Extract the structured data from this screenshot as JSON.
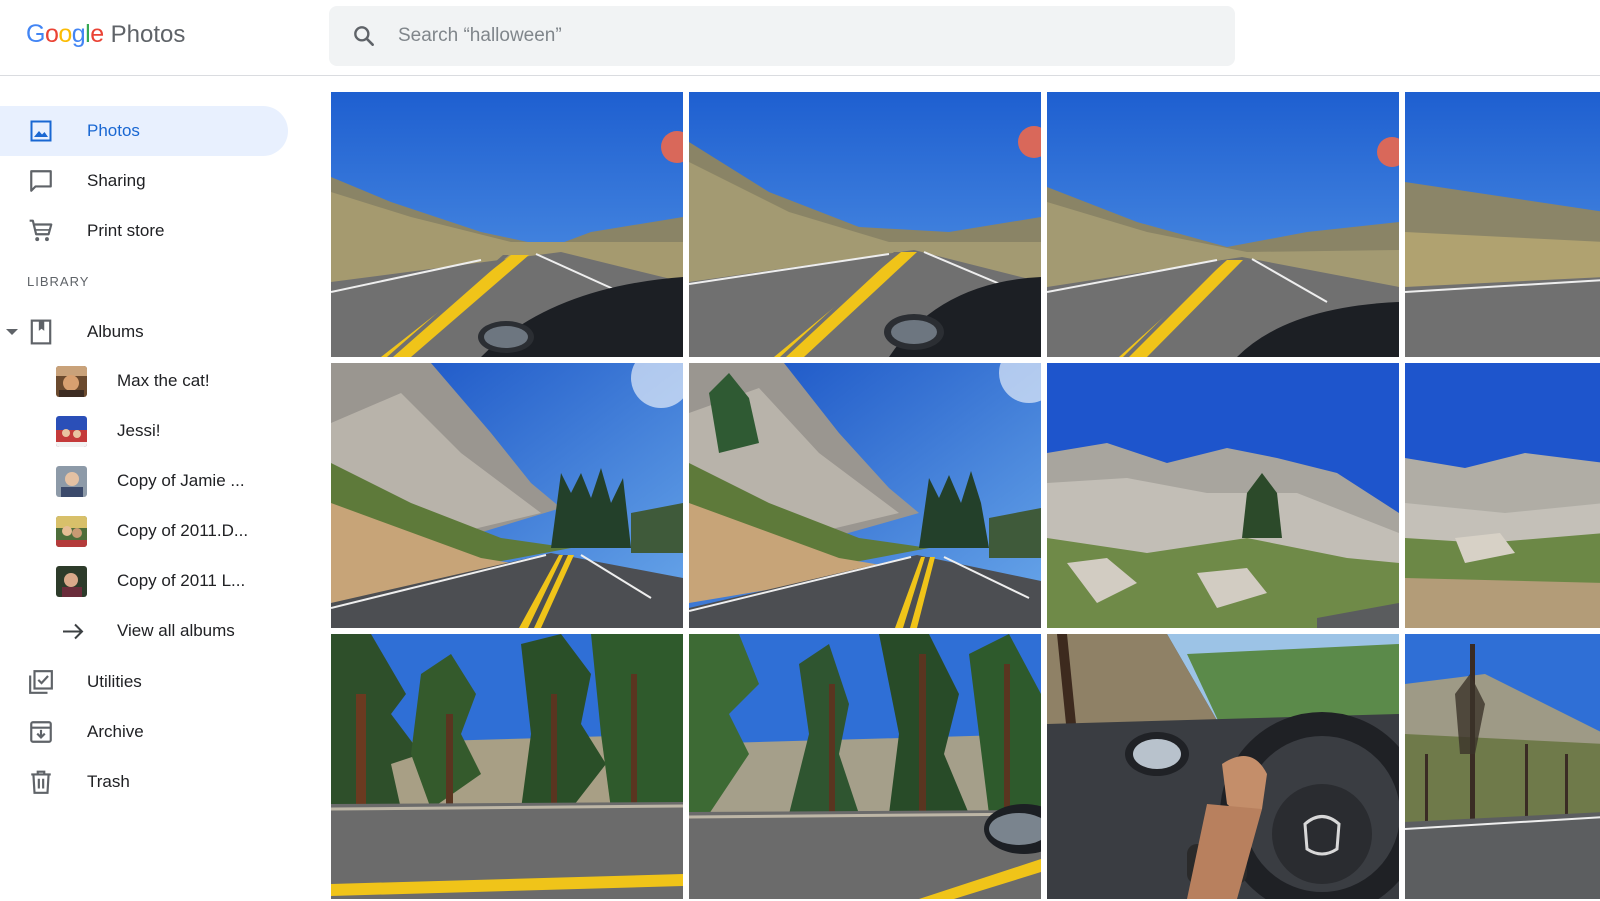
{
  "app": {
    "logo_google": "Google",
    "logo_product": "Photos"
  },
  "search": {
    "placeholder": "Search “halloween”",
    "icon": "search-icon"
  },
  "sidebar": {
    "nav": [
      {
        "label": "Photos",
        "icon": "photo-icon",
        "active": true
      },
      {
        "label": "Sharing",
        "icon": "chat-bubble-icon",
        "active": false
      },
      {
        "label": "Print store",
        "icon": "shopping-cart-icon",
        "active": false
      }
    ],
    "library_title": "LIBRARY",
    "albums_label": "Albums",
    "albums": [
      {
        "label": "Max the cat!"
      },
      {
        "label": "Jessi!"
      },
      {
        "label": "Copy of Jamie ..."
      },
      {
        "label": "Copy of 2011.D..."
      },
      {
        "label": "Copy of 2011 L..."
      }
    ],
    "view_all_label": "View all albums",
    "more": [
      {
        "label": "Utilities",
        "icon": "utilities-icon"
      },
      {
        "label": "Archive",
        "icon": "archive-icon"
      },
      {
        "label": "Trash",
        "icon": "trash-icon"
      }
    ]
  },
  "colors": {
    "accent": "#1967d2",
    "active_bg": "#e8f0fe",
    "search_bg": "#f1f3f4",
    "sky": "#2f6fd6",
    "road": "#6b6b6b",
    "lane_yellow": "#f0c419"
  },
  "photos": [
    {
      "scene": "road-hills"
    },
    {
      "scene": "road-hills"
    },
    {
      "scene": "road-hills"
    },
    {
      "scene": "road-hills"
    },
    {
      "scene": "road-cliff"
    },
    {
      "scene": "road-cliff"
    },
    {
      "scene": "rocky-hill"
    },
    {
      "scene": "rocky-hill"
    },
    {
      "scene": "forest-road"
    },
    {
      "scene": "forest-road"
    },
    {
      "scene": "car-interior"
    },
    {
      "scene": "burnt-trees"
    }
  ]
}
